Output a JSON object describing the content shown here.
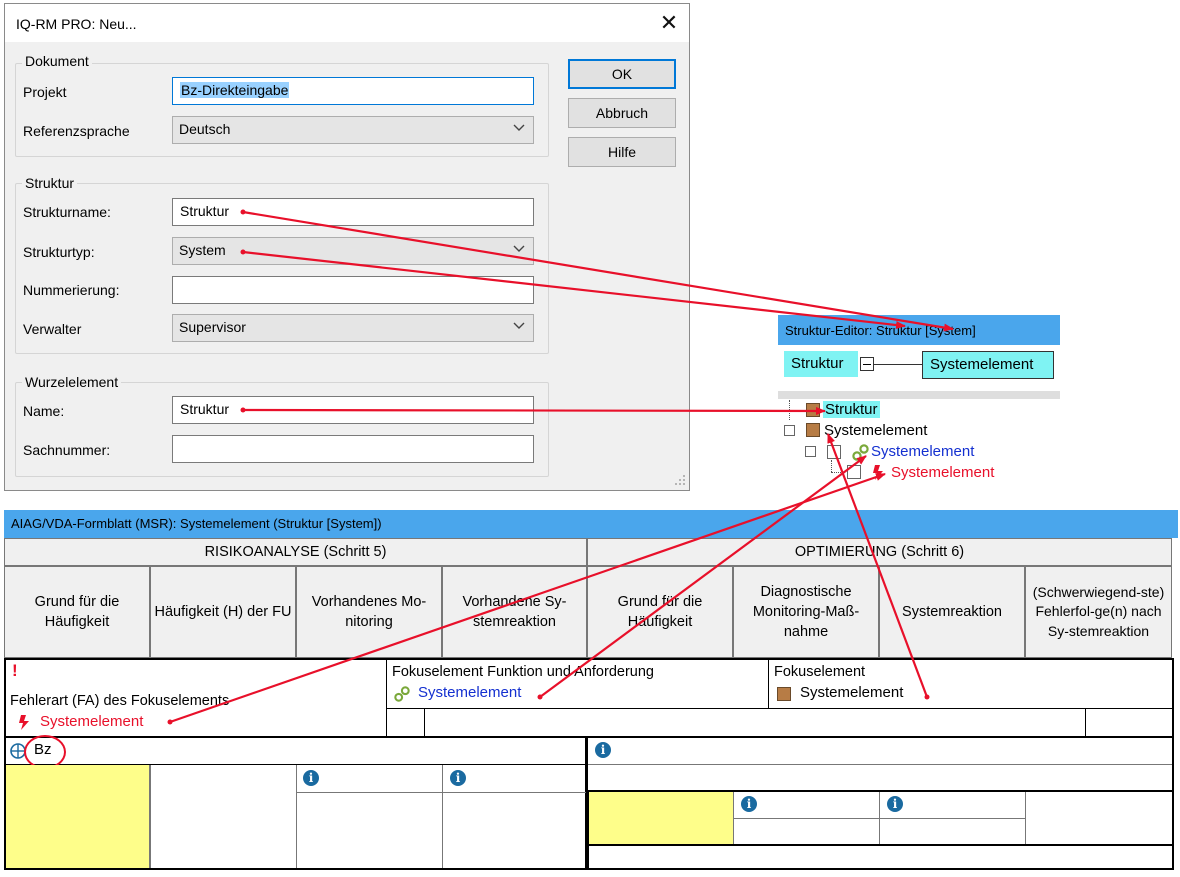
{
  "dialog": {
    "title": "IQ-RM PRO: Neu...",
    "close_glyph": "✕",
    "dokument": {
      "group_label": "Dokument",
      "projekt_label": "Projekt",
      "projekt_value": "Bz-Direkteingabe",
      "referenzsprache_label": "Referenzsprache",
      "referenzsprache_value": "Deutsch"
    },
    "struktur": {
      "group_label": "Struktur",
      "strukturname_label": "Strukturname:",
      "strukturname_value": "Struktur",
      "strukturtyp_label": "Strukturtyp:",
      "strukturtyp_value": "System",
      "nummerierung_label": "Nummerierung:",
      "nummerierung_value": "",
      "verwalter_label": "Verwalter",
      "verwalter_value": "Supervisor"
    },
    "wurzelelement": {
      "group_label": "Wurzelelement",
      "name_label": "Name:",
      "name_value": "Struktur",
      "sachnummer_label": "Sachnummer:",
      "sachnummer_value": ""
    },
    "buttons": {
      "ok": "OK",
      "abbruch": "Abbruch",
      "hilfe": "Hilfe"
    }
  },
  "struktur_editor": {
    "title": "Struktur-Editor: Struktur [System]",
    "root_box": "Struktur",
    "child_box": "Systemelement",
    "tree": {
      "root": "Struktur",
      "level1": "Systemelement",
      "level2_function": "Systemelement",
      "level3_failure": "Systemelement"
    }
  },
  "formblatt": {
    "title": "AIAG/VDA-Formblatt (MSR): Systemelement (Struktur [System])",
    "section_left": "RISIKOANALYSE (Schritt 5)",
    "section_right": "OPTIMIERUNG (Schritt 6)",
    "columns": [
      "Grund für die Häufigkeit",
      "Häufigkeit (H) der FU",
      "Vorhandenes Mo-nitoring",
      "Vorhandene Sy-stemreaktion",
      "Grund für die Häufigkeit",
      "Diagnostische Monitoring-Maß-nahme",
      "Systemreaktion",
      "(Schwerwiegend-ste) Fehlerfol-ge(n) nach Sy-stemreaktion"
    ],
    "fehlerart_label": "Fehlerart (FA) des Fokuselements",
    "fehlerart_value": "Systemelement",
    "funktion_label": "Fokuselement Funktion und Anforderung",
    "funktion_value": "Systemelement",
    "fokuselement_label": "Fokuselement",
    "fokuselement_value": "Systemelement",
    "bz_label": "Bz",
    "exclamation": "!",
    "info_glyph": "i"
  },
  "colors": {
    "titlebar_blue": "#4aa6ec",
    "cyan_box": "#7ff3f3",
    "arrow_red": "#e8102a",
    "link_blue": "#1430d0",
    "element_brown": "#b77c45",
    "highlight_yellow": "#fefe8a"
  },
  "icons": [
    "close-icon",
    "chevron-down-icon",
    "resize-grip-icon",
    "minus-icon",
    "element-square-icon",
    "function-link-icon",
    "failure-bolt-icon",
    "info-icon",
    "exclamation-icon",
    "frequency-icon"
  ]
}
